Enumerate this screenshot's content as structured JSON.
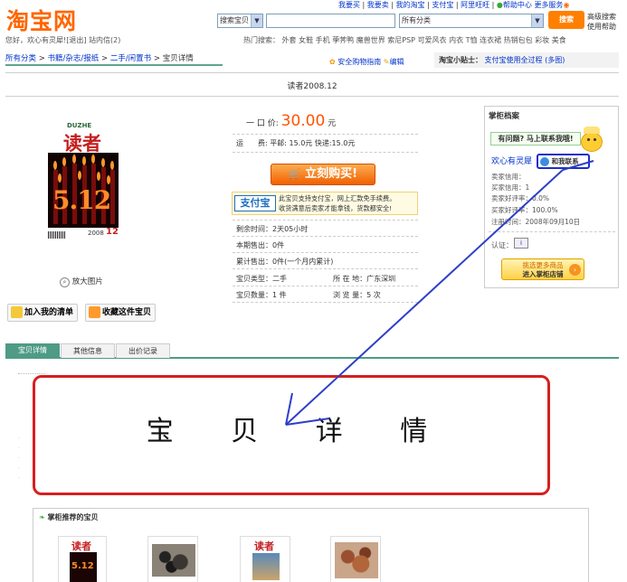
{
  "header": {
    "logo": "淘宝网",
    "top_links": [
      "我要买",
      "我要卖",
      "我的淘宝",
      "支付宝",
      "阿里旺旺"
    ],
    "help_center": "帮助中心",
    "more_services": "更多服务",
    "welcome": "您好，欢心有灵犀!",
    "logout": "[退出]",
    "messages": "站内信(2)",
    "search_type": "搜索宝贝",
    "search_value": "",
    "category_select": "所有分类",
    "search_button": "搜索",
    "adv_search": "高级搜索",
    "use_help": "使用帮助",
    "hot_label": "热门搜索：",
    "hot_terms": [
      "外套",
      "女鞋",
      "手机",
      "荸荠鸭",
      "魔兽世界",
      "索尼PSP",
      "可爱风衣",
      "内衣",
      "T恤",
      "连衣裙",
      "热销包包",
      "彩妆",
      "美食"
    ]
  },
  "breadcrumb": [
    "所有分类",
    "书籍/杂志/报纸",
    "二手/闲置书",
    "宝贝详情"
  ],
  "tips": {
    "safe_guide": "安全购物指南",
    "edit": "编辑",
    "xiaotieshi_label": "淘宝小贴士：",
    "xiaotieshi_link": "支付宝使用全过程 (多图)"
  },
  "item": {
    "title": "读者2008.12",
    "price_label": "一 口 价:",
    "price": "30.00",
    "price_unit": "元",
    "shipping_label": "运　　费:",
    "shipping": "平邮: 15.0元 快递:15.0元",
    "buy_button": "立刻购买!",
    "alipay_logo": "支付宝",
    "alipay_line1": "此宝贝支持支付宝，网上汇款免手续费。",
    "alipay_line2": "收货满意后卖家才能拿钱，货款都安全!",
    "time_left_label": "剩余时间：",
    "time_left": "2天05小时",
    "sold_period_label": "本期售出：",
    "sold_period": "0件",
    "sold_total_label": "累计售出：",
    "sold_total": "0件(一个月内累计)",
    "type_label": "宝贝类型：",
    "type": "二手",
    "location_label": "所 在 地：",
    "location": "广东深圳",
    "qty_label": "宝贝数量：",
    "qty": "1 件",
    "views_label": "浏 览 量：",
    "views": "5 次",
    "zoom": "放大图片",
    "add_list": "加入我的清单",
    "favorite": "收藏这件宝贝"
  },
  "cover": {
    "brand_en": "DUZHE",
    "brand": "读者",
    "numbers": "5.12",
    "year": "2008",
    "issue": "12"
  },
  "seller": {
    "box_title": "掌柜档案",
    "question": "有问题? 马上联系我哦!",
    "name": "欢心有灵犀",
    "contact": "和我联系",
    "credit_label": "卖家信用：",
    "buyer_credit": "买家信用：1",
    "seller_rate": "卖家好评率：0.0%",
    "buyer_rate": "买家好评率：100.0%",
    "reg_date": "注册时间：2008年09月10日",
    "cert_label": "认证：",
    "enter_shop_line1": "挑选更多商品",
    "enter_shop_line2": "进入掌柜店铺"
  },
  "tabs": [
    "宝贝详情",
    "其他信息",
    "出价记录"
  ],
  "annotation": {
    "text": "宝 贝 详 情",
    "color": "#d61f1f",
    "arrow_color": "#2d3fc8"
  },
  "recommend": {
    "title": "掌柜推荐的宝贝"
  },
  "colors": {
    "brand_orange": "#ff6600",
    "tab_green": "#4f9b85",
    "link_blue": "#0033cc"
  }
}
